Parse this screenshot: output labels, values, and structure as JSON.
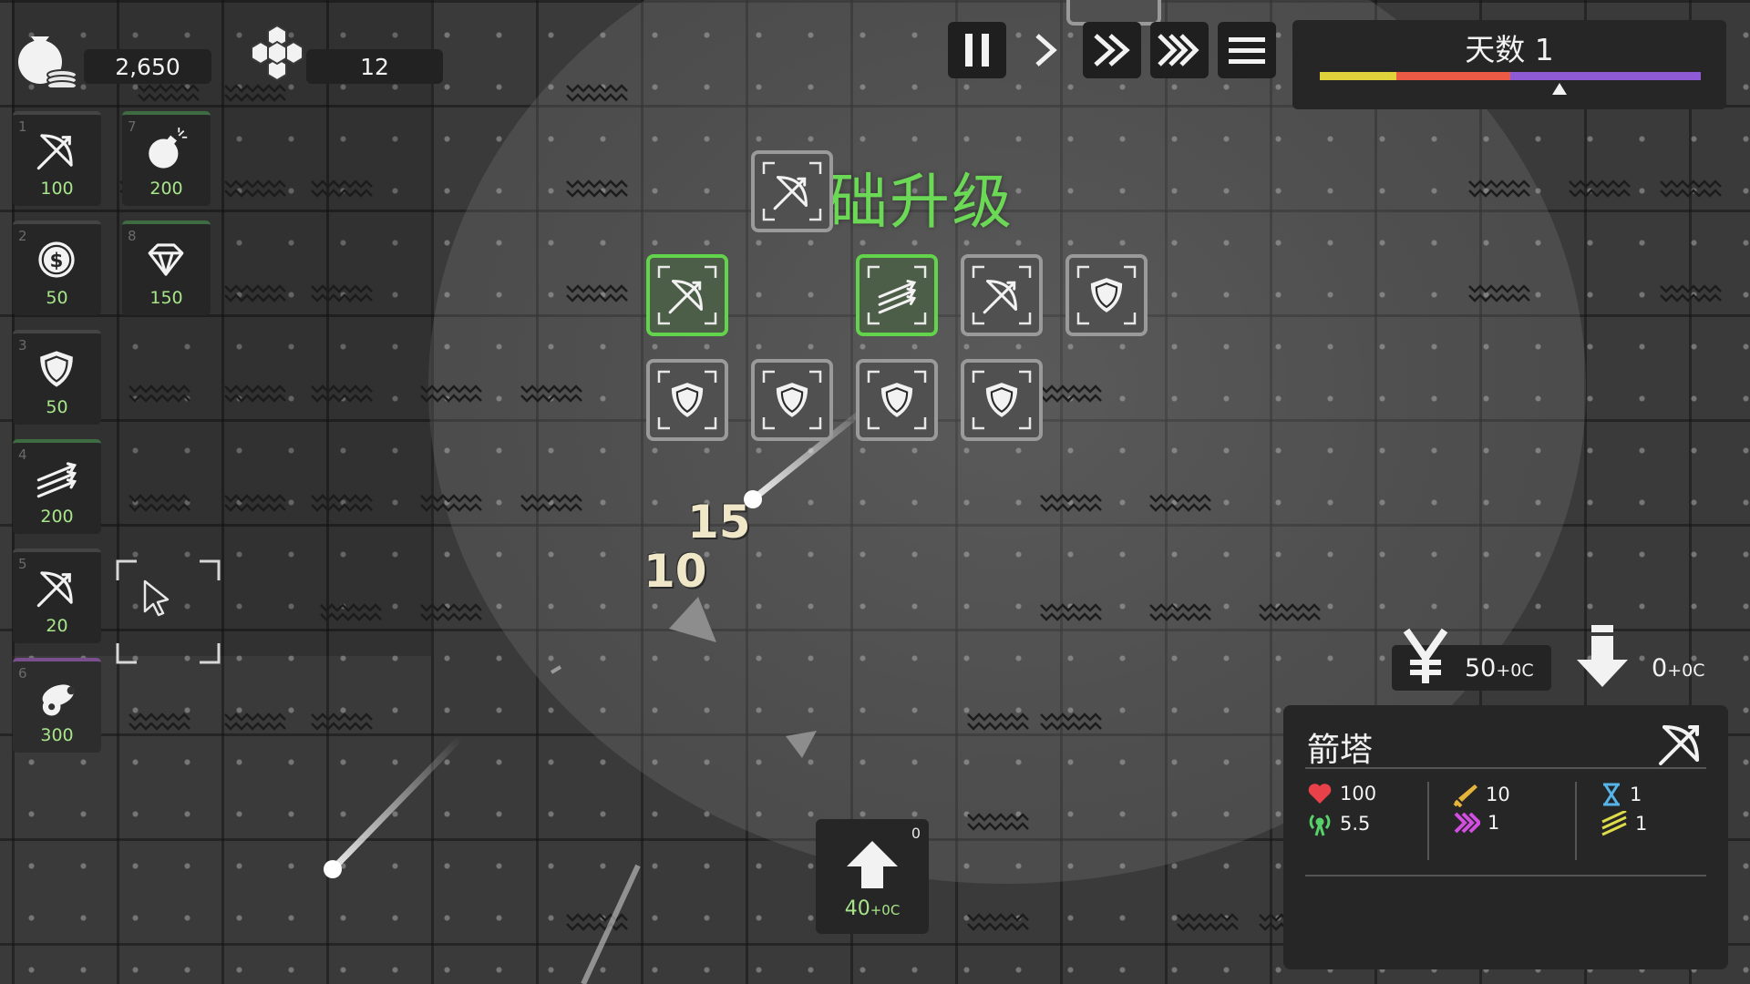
{
  "resources": {
    "gold": "2,650",
    "crystals": "12"
  },
  "controls": [
    {
      "name": "pause-button",
      "icon": "pause-icon"
    },
    {
      "name": "play-button",
      "icon": "play-icon"
    },
    {
      "name": "fast-button",
      "icon": "fast-forward-icon"
    },
    {
      "name": "faster-button",
      "icon": "fastest-forward-icon"
    },
    {
      "name": "menu-button",
      "icon": "menu-icon"
    }
  ],
  "day": {
    "label": "天数 1",
    "progress": 0.63,
    "segments": [
      {
        "color": "#e0d23a",
        "portion": 0.2
      },
      {
        "color": "#ea5a45",
        "portion": 0.3
      },
      {
        "color": "#e84c6a",
        "portion": 0.0
      },
      {
        "color": "#8e5ad6",
        "portion": 0.5
      }
    ]
  },
  "shop": [
    {
      "key": "1",
      "icon": "bow-icon",
      "price": "100"
    },
    {
      "key": "2",
      "icon": "coin-icon",
      "price": "50"
    },
    {
      "key": "3",
      "icon": "shield-icon",
      "price": "50"
    },
    {
      "key": "4",
      "icon": "arrows-icon",
      "price": "200"
    },
    {
      "key": "5",
      "icon": "bow-icon",
      "price": "20"
    },
    {
      "key": "6",
      "icon": "cannon-icon",
      "price": "300"
    },
    {
      "key": "7",
      "icon": "bomb-icon",
      "price": "200"
    },
    {
      "key": "8",
      "icon": "diamond-icon",
      "price": "150"
    }
  ],
  "upgrade_tree": {
    "title": "基础升级",
    "nodes": [
      {
        "icon": "bow-icon",
        "selected": false
      },
      {
        "icon": "bow-icon",
        "selected": true
      },
      {
        "icon": "arrows-icon",
        "selected": true
      },
      {
        "icon": "bow-icon",
        "selected": false
      },
      {
        "icon": "shield-icon",
        "selected": false
      },
      {
        "icon": "shield-icon",
        "selected": false
      },
      {
        "icon": "shield-icon",
        "selected": false
      },
      {
        "icon": "shield-icon",
        "selected": false
      },
      {
        "icon": "shield-icon",
        "selected": false
      }
    ]
  },
  "floating_numbers": [
    "15",
    "10"
  ],
  "costs": {
    "sell_value": "50",
    "sell_suffix": "+0C",
    "down_value": "0",
    "down_suffix": "+0C"
  },
  "upgrade_button": {
    "badge": "0",
    "cost": "40",
    "cost_suffix": "+0C"
  },
  "tower_info": {
    "name": "箭塔",
    "health": "100",
    "damage": "10",
    "cooldown": "1",
    "range": "5.5",
    "speed": "1",
    "multishot": "1"
  },
  "colors": {
    "accent_green": "#6bd956",
    "price_green": "#a8e58a",
    "health_red": "#e8414a",
    "damage_yellow": "#e4b43a",
    "speed_pink": "#d24ee0",
    "range_green": "#56d26a",
    "cooldown_blue": "#55b4e8",
    "multishot_yellow": "#dfdc4a"
  }
}
